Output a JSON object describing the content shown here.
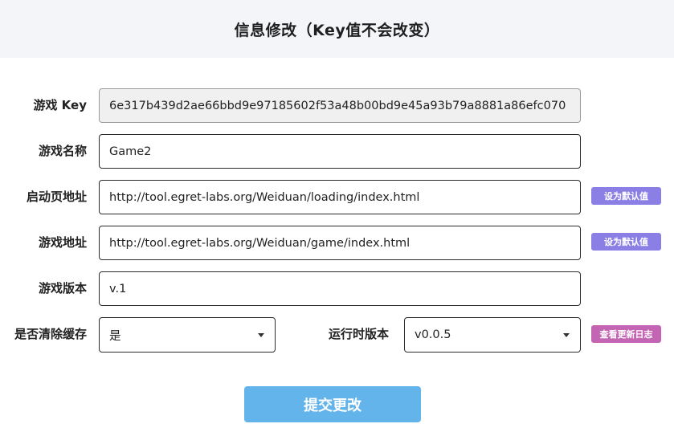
{
  "header": {
    "title": "信息修改（Key值不会改变）"
  },
  "form": {
    "game_key": {
      "label": "游戏 Key",
      "value": "6e317b439d2ae66bbd9e97185602f53a48b00bd9e45a93b79a8881a86efc070"
    },
    "game_name": {
      "label": "游戏名称",
      "value": "Game2"
    },
    "loading_url": {
      "label": "启动页地址",
      "value": "http://tool.egret-labs.org/Weiduan/loading/index.html",
      "default_button": "设为默认值"
    },
    "game_url": {
      "label": "游戏地址",
      "value": "http://tool.egret-labs.org/Weiduan/game/index.html",
      "default_button": "设为默认值"
    },
    "game_version": {
      "label": "游戏版本",
      "value": "v.1"
    },
    "clear_cache": {
      "label": "是否清除缓存",
      "selected": "是"
    },
    "runtime_version": {
      "label": "运行时版本",
      "selected": "v0.0.5",
      "changelog_button": "查看更新日志"
    },
    "submit_label": "提交更改"
  },
  "colors": {
    "header_bg": "#f3f5f9",
    "default_button_bg": "#8b7fe6",
    "changelog_button_bg": "#c465b4",
    "submit_bg": "#64b4ec"
  },
  "icons": {
    "select_arrow": "caret-down-icon"
  }
}
